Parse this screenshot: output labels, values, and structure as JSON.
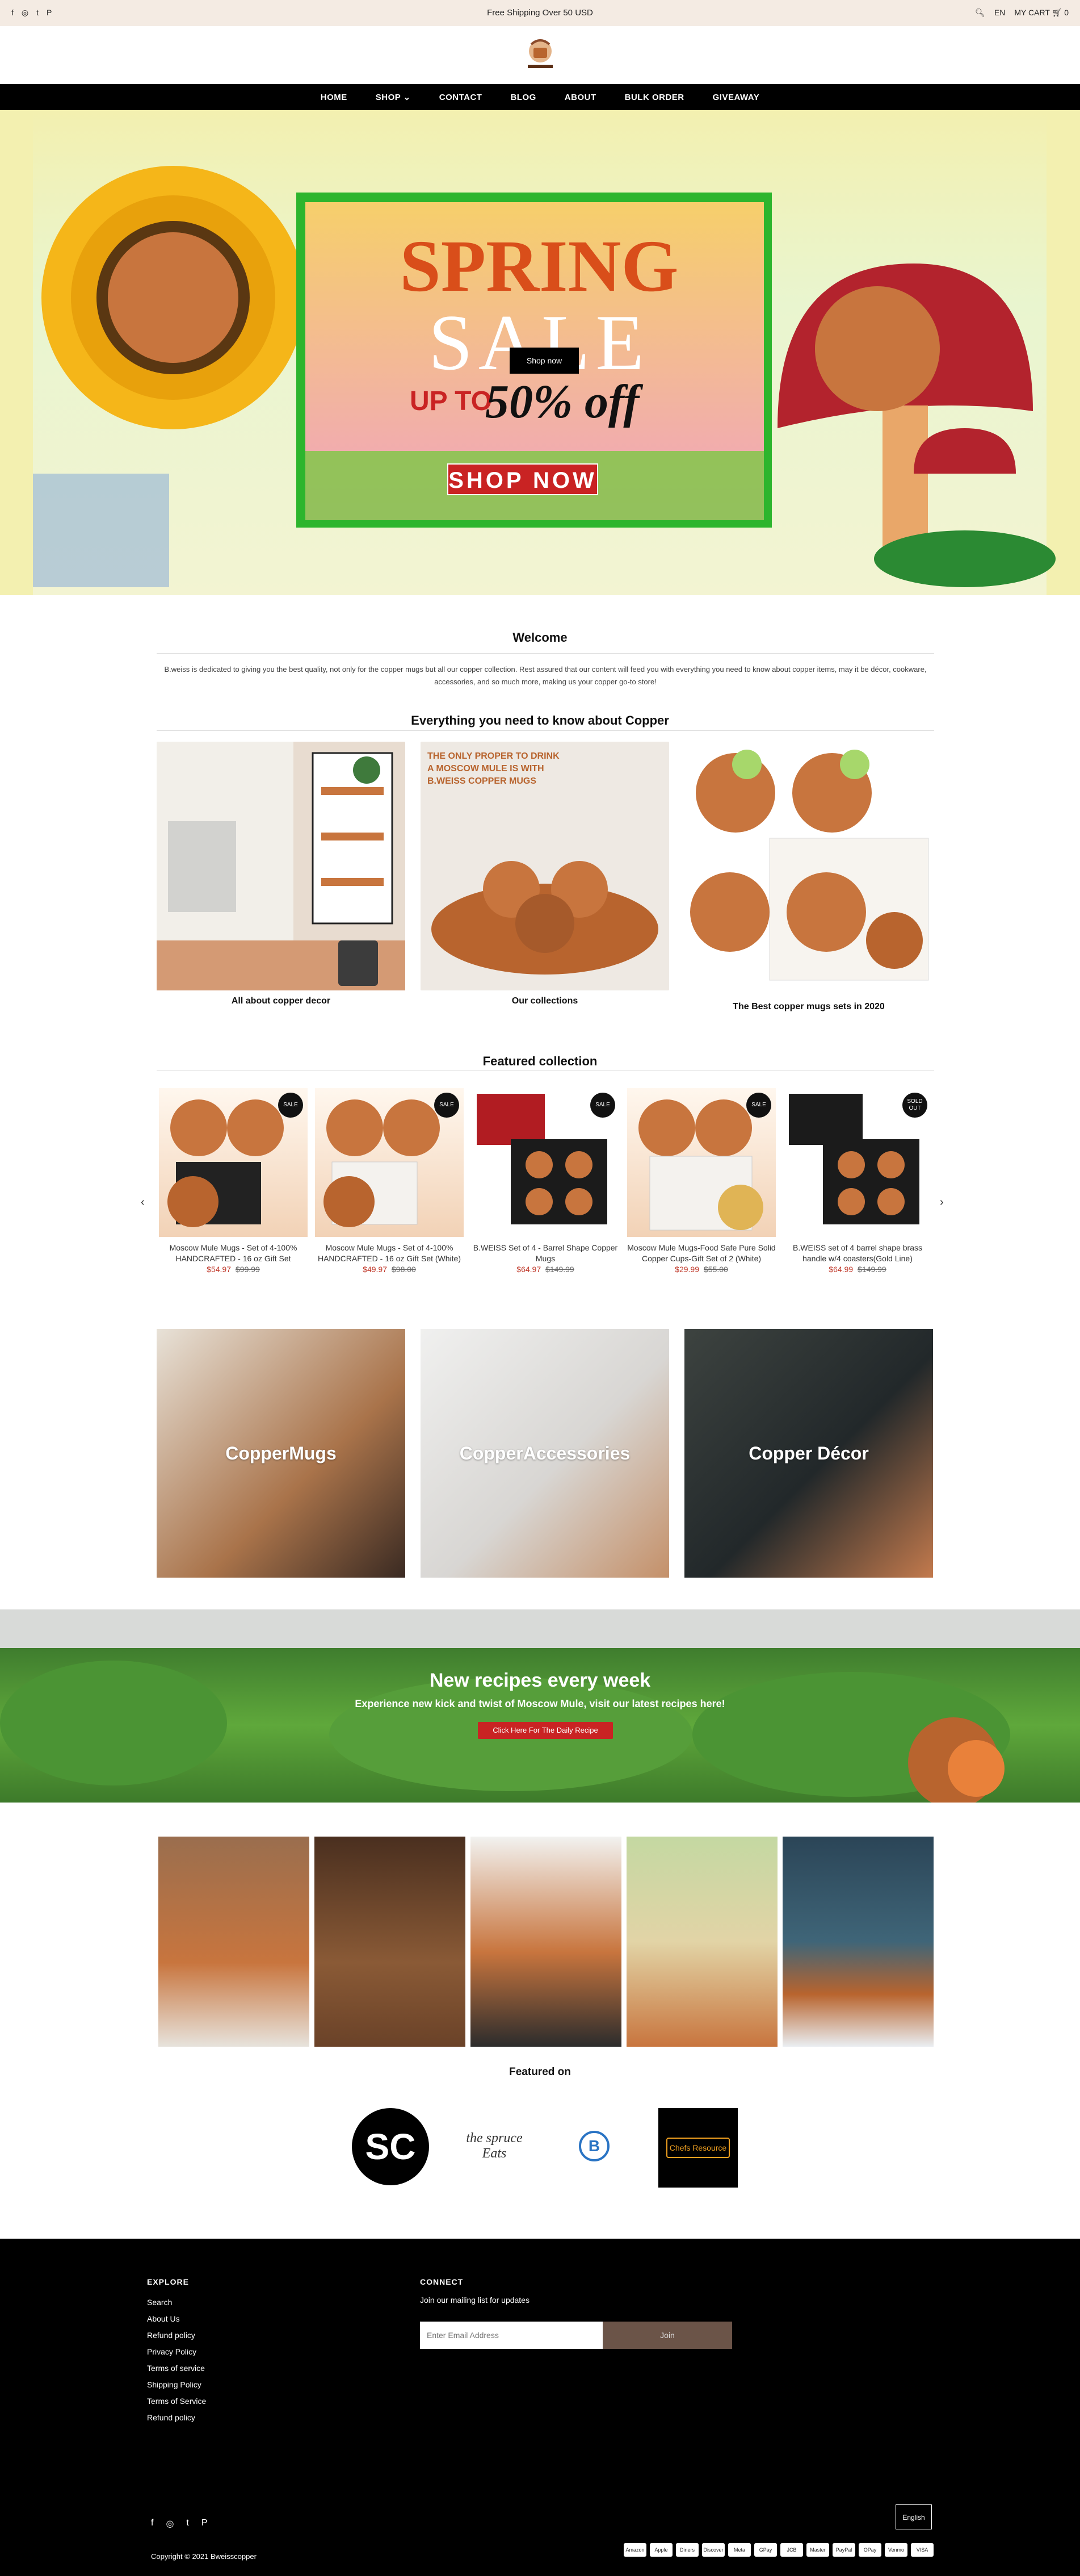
{
  "topbar": {
    "shipping": "Free Shipping Over 50 USD",
    "lang": "EN",
    "cart": "MY CART",
    "cart_count": "0",
    "social": [
      "f",
      "◎",
      "t",
      "P"
    ]
  },
  "nav": [
    "HOME",
    "SHOP",
    "CONTACT",
    "BLOG",
    "ABOUT",
    "BULK ORDER",
    "GIVEAWAY"
  ],
  "hero": {
    "line1": "SPRING",
    "line2": "SALE",
    "line3a": "UP TO",
    "line3b": "50% off",
    "shop_now": "SHOP NOW",
    "button": "Shop now"
  },
  "welcome": {
    "title": "Welcome",
    "text": "B.weiss is dedicated to giving you the best quality, not only for the copper mugs but all our copper collection. Rest assured that our content will feed you with everything you need to know about copper items, may it be décor, cookware, accessories, and so much more, making us your copper go-to store!"
  },
  "copper_section": {
    "title": "Everything you need to know about Copper",
    "cards": [
      {
        "caption": "All about copper decor"
      },
      {
        "caption": "Our collections"
      },
      {
        "caption": "The Best copper mugs sets in 2020"
      }
    ]
  },
  "featured": {
    "title": "Featured collection",
    "products": [
      {
        "name": "Moscow Mule Mugs - Set of 4-100% HANDCRAFTED - 16 oz Gift Set",
        "price": "$54.97",
        "old": "$99.99",
        "badge": "SALE"
      },
      {
        "name": "Moscow Mule Mugs - Set of 4-100% HANDCRAFTED - 16 oz Gift Set (White)",
        "price": "$49.97",
        "old": "$98.00",
        "badge": "SALE"
      },
      {
        "name": "B.WEISS Set of 4 - Barrel Shape Copper Mugs",
        "price": "$64.97",
        "old": "$149.99",
        "badge": "SALE"
      },
      {
        "name": "Moscow Mule Mugs-Food Safe Pure Solid Copper Cups-Gift Set of 2 (White)",
        "price": "$29.99",
        "old": "$55.00",
        "badge": "SALE"
      },
      {
        "name": "B.WEISS set of 4 barrel shape brass handle w/4 coasters(Gold Line)",
        "price": "$64.99",
        "old": "$149.99",
        "badge": "SOLD OUT"
      }
    ]
  },
  "collections": [
    "CopperMugs",
    "CopperAccessories",
    "Copper Décor"
  ],
  "recipes": {
    "title": "New recipes every week",
    "subtitle": "Experience new kick and twist of Moscow Mule, visit our latest recipes here!",
    "button": "Click Here For The Daily Recipe"
  },
  "featured_on": {
    "title": "Featured on",
    "logos": [
      "SC",
      "the spruce Eats",
      "B",
      "Chefs Resource"
    ]
  },
  "footer": {
    "explore_title": "EXPLORE",
    "explore": [
      "Search",
      "About Us",
      "Refund policy",
      "Privacy Policy",
      "Terms of service",
      "Shipping Policy",
      "Terms of Service",
      "Refund policy"
    ],
    "connect_title": "CONNECT",
    "connect_text": "Join our mailing list for updates",
    "email_placeholder": "Enter Email Address",
    "join": "Join",
    "lang_button": "English",
    "copyright": "Copyright © 2021 Bweisscopper",
    "payments": [
      "Amazon",
      "Apple",
      "Diners",
      "Discover",
      "Meta",
      "GPay",
      "JCB",
      "Master",
      "PayPal",
      "OPay",
      "Venmo",
      "VISA"
    ]
  }
}
